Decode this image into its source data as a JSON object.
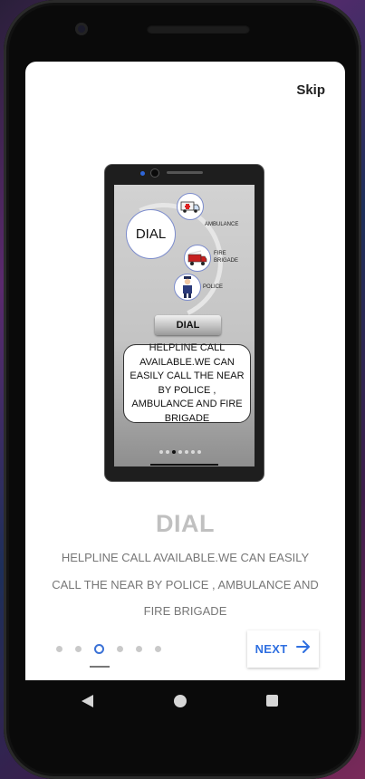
{
  "header": {
    "skip_label": "Skip"
  },
  "illustration": {
    "dial_circle_text": "DIAL",
    "services": [
      {
        "label": "AMBULANCE",
        "icon": "ambulance-icon"
      },
      {
        "label": "FIRE BRIGADE",
        "icon": "fire-truck-icon"
      },
      {
        "label": "POLICE",
        "icon": "police-officer-icon"
      }
    ],
    "dial_button_text": "DIAL",
    "bubble_text": "HELPLINE CALL AVAILABLE.WE CAN EASILY CALL THE NEAR BY POLICE , AMBULANCE AND FIRE BRIGADE",
    "page_dots_total": 7,
    "page_dots_active": 2
  },
  "slide": {
    "title": "DIAL",
    "description": "HELPLINE CALL AVAILABLE.WE CAN EASILY CALL THE NEAR BY POLICE , AMBULANCE AND FIRE BRIGADE"
  },
  "pager": {
    "total": 6,
    "active_index": 2
  },
  "footer": {
    "next_label": "NEXT",
    "next_icon": "arrow-right-icon"
  },
  "colors": {
    "accent": "#2f6fe0",
    "title": "#c0c0c0",
    "text": "#777777"
  }
}
